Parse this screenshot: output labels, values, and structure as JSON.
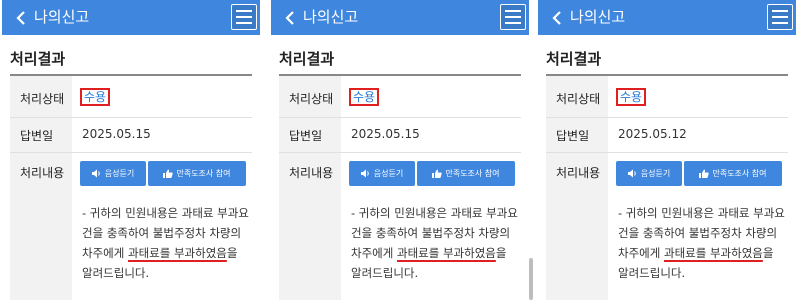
{
  "colors": {
    "accent": "#3f87de",
    "highlight_border": "#e02020",
    "status_text": "#2a7bd5"
  },
  "panels": [
    {
      "header": {
        "title": "나의신고",
        "back_icon": "chevron-left-icon",
        "menu_icon": "hamburger-menu-icon"
      },
      "section_title": "처리결과",
      "labels": {
        "status": "처리상태",
        "answer_date": "답변일",
        "content": "처리내용"
      },
      "status_value": "수용",
      "answer_date_value": "2025.05.15",
      "buttons": {
        "voice": "음성듣기",
        "survey": "만족도조사 참여"
      },
      "content": {
        "line1": "- 귀하의 민원내용은 과태료 부과요",
        "line2": "건을 충족하여 불법주정차 차량의",
        "line3_pre": "차주에게 ",
        "line3_underlined": "과태료를 부과하였음",
        "line3_post": "을",
        "line4": "알려드립니다."
      }
    },
    {
      "header": {
        "title": "나의신고",
        "back_icon": "chevron-left-icon",
        "menu_icon": "hamburger-menu-icon"
      },
      "section_title": "처리결과",
      "labels": {
        "status": "처리상태",
        "answer_date": "답변일",
        "content": "처리내용"
      },
      "status_value": "수용",
      "answer_date_value": "2025.05.15",
      "buttons": {
        "voice": "음성듣기",
        "survey": "만족도조사 참여"
      },
      "content": {
        "line1": "- 귀하의 민원내용은 과태료 부과요",
        "line2": "건을 충족하여 불법주정차 차량의",
        "line3_pre": "차주에게 ",
        "line3_underlined": "과태료를 부과하였음",
        "line3_post": "을",
        "line4": "알려드립니다."
      }
    },
    {
      "header": {
        "title": "나의신고",
        "back_icon": "chevron-left-icon",
        "menu_icon": "hamburger-menu-icon"
      },
      "section_title": "처리결과",
      "labels": {
        "status": "처리상태",
        "answer_date": "답변일",
        "content": "처리내용"
      },
      "status_value": "수용",
      "answer_date_value": "2025.05.12",
      "buttons": {
        "voice": "음성듣기",
        "survey": "만족도조사 참여"
      },
      "content": {
        "line1": "- 귀하의 민원내용은 과태료 부과요",
        "line2": "건을 충족하여 불법주정차 차량의",
        "line3_pre": "차주에게 ",
        "line3_underlined": "과태료를 부과하였음",
        "line3_post": "을",
        "line4": "알려드립니다."
      }
    }
  ]
}
